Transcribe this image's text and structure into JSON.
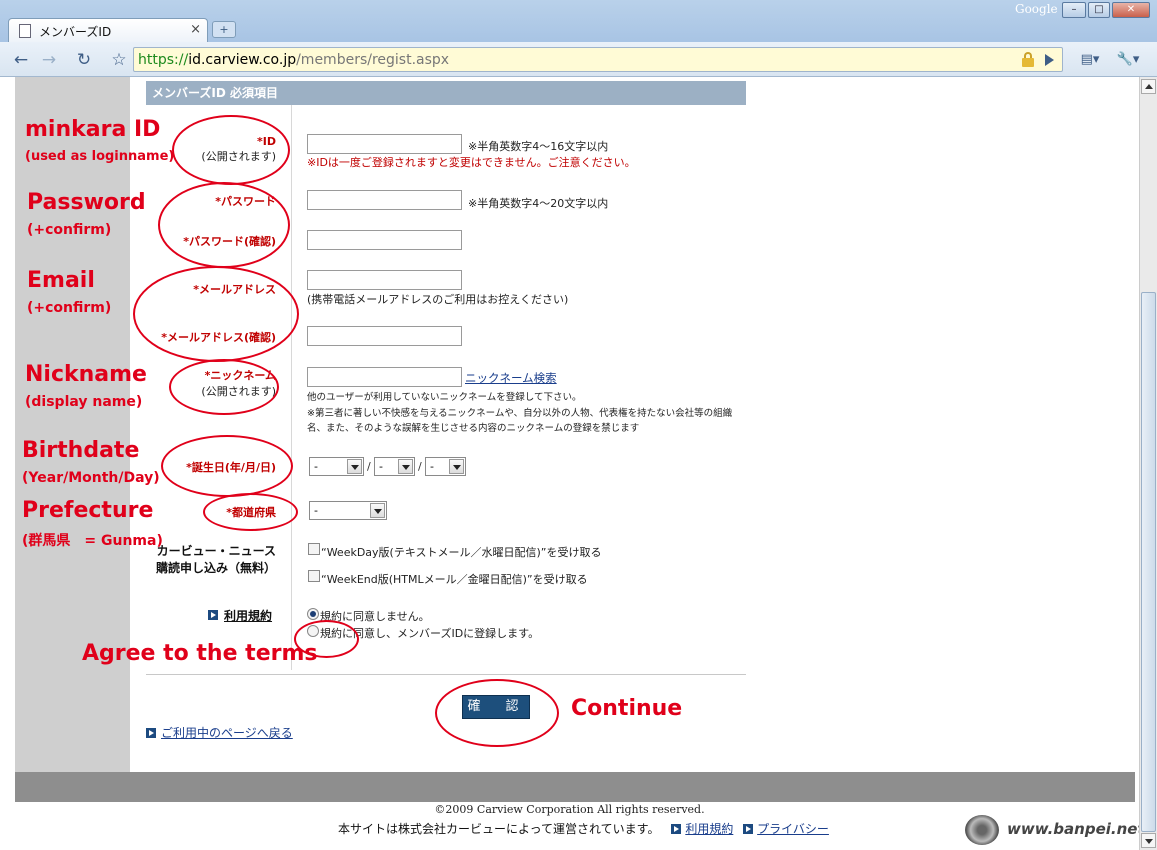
{
  "browser": {
    "tab_title": "メンバーズID",
    "tab_close": "×",
    "new_tab": "+",
    "google_label": "Google",
    "window_buttons": [
      "–",
      "□",
      "✕"
    ],
    "nav": {
      "back": "←",
      "forward": "→",
      "reload": "↻",
      "star": "☆",
      "page_menu": "▤▾",
      "tools_menu": "🔧▾"
    },
    "url": {
      "scheme": "https://",
      "host": "id.carview.co.jp",
      "path": "/members/regist.aspx"
    }
  },
  "form": {
    "section_header": "メンバーズID 必須項目",
    "id": {
      "label": "*ID",
      "sub": "(公開されます)",
      "hint": "※半角英数字4～16文字以内",
      "warning": "※IDは一度ご登録されますと変更はできません。ご注意ください。",
      "value": ""
    },
    "password": {
      "label": "*パスワード",
      "hint": "※半角英数字4～20文字以内",
      "value": ""
    },
    "password_confirm": {
      "label": "*パスワード(確認)",
      "value": ""
    },
    "email": {
      "label": "*メールアドレス",
      "hint": "(携帯電話メールアドレスのご利用はお控えください)",
      "value": ""
    },
    "email_confirm": {
      "label": "*メールアドレス(確認)",
      "value": ""
    },
    "nickname": {
      "label": "*ニックネーム",
      "sub": "(公開されます)",
      "search_link": "ニックネーム検索",
      "note1": "他のユーザーが利用していないニックネームを登録して下さい。",
      "note2": "※第三者に著しい不快感を与えるニックネームや、自分以外の人物、代表権を持たない会社等の組織",
      "note3": "名、また、そのような誤解を生じさせる内容のニックネームの登録を禁じます",
      "value": ""
    },
    "birthdate": {
      "label": "*誕生日(年/月/日)",
      "year": "-",
      "month": "-",
      "day": "-",
      "sep": "/"
    },
    "prefecture": {
      "label": "*都道府県",
      "value": "-"
    },
    "newsletter": {
      "label_line1": "カービュー・ニュース",
      "label_line2": "購読申し込み（無料）",
      "option1": "“WeekDay版(テキストメール／水曜日配信)”を受け取る",
      "option2": "“WeekEnd版(HTMLメール／金曜日配信)”を受け取る",
      "option1_checked": false,
      "option2_checked": false
    },
    "terms": {
      "link": "利用規約",
      "disagree": "規約に同意しません。",
      "agree": "規約に同意し、メンバーズIDに登録します。",
      "selected": "disagree"
    },
    "confirm_button": "確　認",
    "back_link": "ご利用中のページへ戻る"
  },
  "footer": {
    "copyright": "©2009 Carview Corporation All rights reserved.",
    "operator": "本サイトは株式会社カービューによって運営されています。",
    "terms_link": "利用規約",
    "privacy_link": "プライバシー"
  },
  "annotations": {
    "minkara_id": "minkara ID",
    "minkara_id_sub": "(used as loginname)",
    "password": "Password",
    "password_sub": "(+confirm)",
    "email": "Email",
    "email_sub": "(+confirm)",
    "nickname": "Nickname",
    "nickname_sub": "(display name)",
    "birthdate": "Birthdate",
    "birthdate_sub": "(Year/Month/Day)",
    "prefecture": "Prefecture",
    "prefecture_sub": "(群馬県　= Gunma)",
    "agree": "Agree to the terms",
    "continue": "Continue",
    "watermark": "www.banpei.net",
    "color": "#e0001a"
  }
}
